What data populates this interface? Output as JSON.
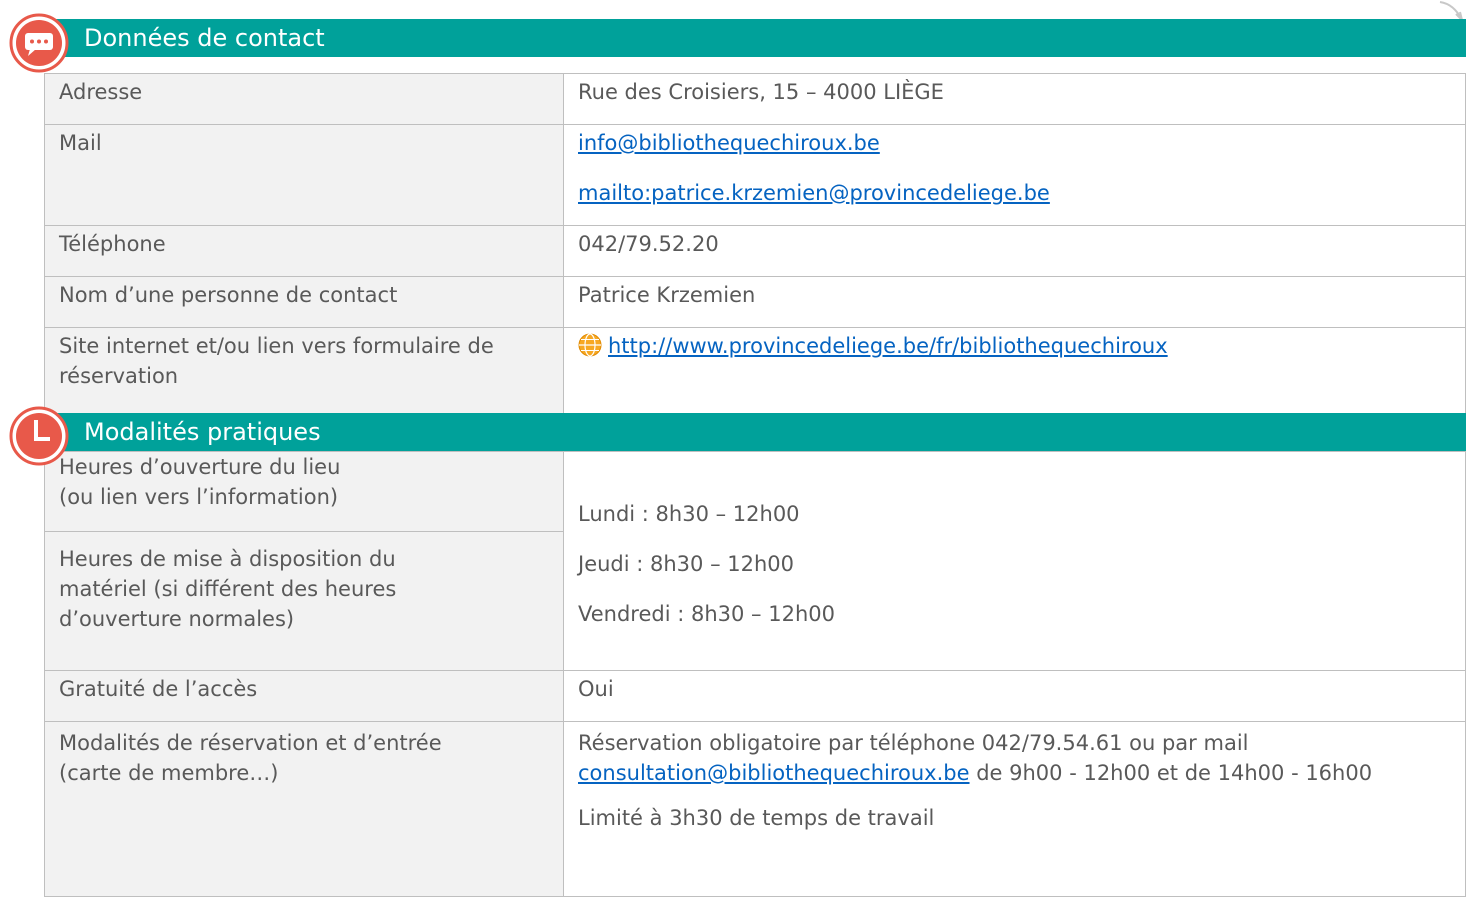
{
  "contact": {
    "header": "Données de contact",
    "rows": {
      "address": {
        "label": "Adresse",
        "value": "Rue des Croisiers, 15 – 4000 LIÈGE"
      },
      "mail": {
        "label": "Mail",
        "link1": "info@bibliothequechiroux.be",
        "link2": "mailto:patrice.krzemien@provincedeliege.be"
      },
      "phone": {
        "label": "Téléphone",
        "value": "042/79.52.20"
      },
      "contact_person": {
        "label": "Nom d’une personne de contact",
        "value": "Patrice Krzemien"
      },
      "website": {
        "label": "Site internet et/ou lien vers formulaire de réservation",
        "link": "http://www.provincedeliege.be/fr/bibliothequechiroux"
      }
    }
  },
  "modalites": {
    "header": "Modalités pratiques",
    "rows": {
      "opening_hours": {
        "label_line1": "Heures d’ouverture du lieu",
        "label_line2": "(ou lien vers l’information)"
      },
      "availability_hours": {
        "label": "Heures de mise à disposition du matériel (si différent des heures d’ouverture normales)"
      },
      "hours_values": [
        "Lundi : 8h30 – 12h00",
        "Jeudi : 8h30 – 12h00",
        "Vendredi : 8h30 – 12h00"
      ],
      "free_access": {
        "label": "Gratuité de l’accès",
        "value": "Oui"
      },
      "reservation": {
        "label": "Modalités de réservation et d’entrée (carte de membre…)",
        "text_before": "Réservation obligatoire par téléphone 042/79.54.61 ou par mail ",
        "link": "consultation@bibliothequechiroux.be",
        "text_after": " de 9h00 - 12h00 et de 14h00 - 16h00",
        "limit": "Limité à 3h30 de temps de travail"
      }
    }
  },
  "colors": {
    "header_bg": "#00a19a",
    "icon_red": "#e8594a",
    "link": "#0563c1",
    "label_bg": "#f2f2f2",
    "text": "#595959"
  },
  "icons": {
    "contact": "speech-bubble-icon",
    "modalites": "clock-icon",
    "website": "globe-icon"
  }
}
